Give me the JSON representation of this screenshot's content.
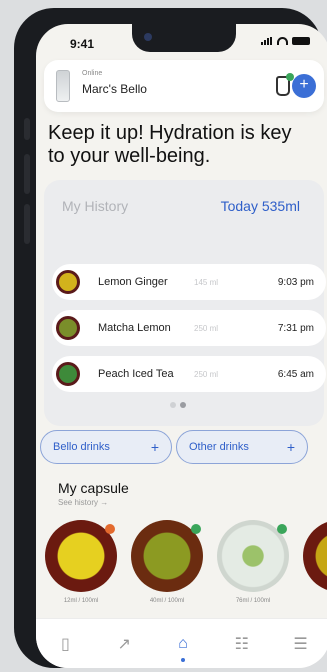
{
  "status": {
    "time": "9:41"
  },
  "header": {
    "status": "Online",
    "name": "Marc's Bello"
  },
  "headline": "Keep it up! Hydration is key to your well-being.",
  "history": {
    "title": "My History",
    "today_label": "Today",
    "today_value": "535ml",
    "drinks": [
      {
        "name": "Lemon Ginger",
        "ml": "145 ml",
        "time": "9:03 pm",
        "color": "#d2b21c"
      },
      {
        "name": "Matcha Lemon",
        "ml": "250 ml",
        "time": "7:31 pm",
        "color": "#7a8e2a"
      },
      {
        "name": "Peach Iced Tea",
        "ml": "250 ml",
        "time": "6:45 am",
        "color": "#3e8a3a"
      }
    ]
  },
  "buttons": {
    "bello": "Bello drinks",
    "other": "Other drinks"
  },
  "capsule": {
    "title": "My capsule",
    "link": "See history →",
    "items": [
      {
        "ml": "12ml / 100ml",
        "dot": "#e36a2e",
        "color": "#e6d020"
      },
      {
        "ml": "40ml / 100ml",
        "dot": "#3aa55a",
        "color": "#8c9a22"
      },
      {
        "ml": "76ml / 100ml",
        "dot": "#3aa55a",
        "color": "#e4ebe4"
      },
      {
        "ml": "",
        "dot": "#3aa55a",
        "color": "#c6a614"
      }
    ]
  },
  "colors": {
    "accent": "#3b6fd6",
    "online": "#3aa55a"
  }
}
